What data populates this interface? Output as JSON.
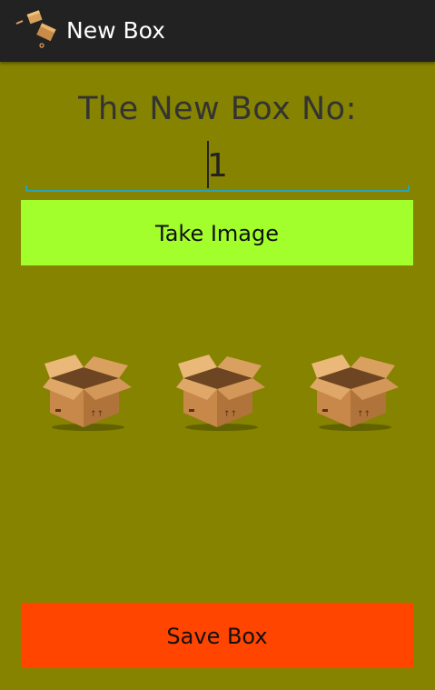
{
  "action_bar": {
    "title": "New Box",
    "icon": "box-app-icon"
  },
  "form": {
    "heading": "The New Box No:",
    "box_number_value": "1"
  },
  "buttons": {
    "take_image": "Take Image",
    "save_box": "Save Box"
  },
  "images": [
    {
      "icon": "cardboard-box-icon"
    },
    {
      "icon": "cardboard-box-icon"
    },
    {
      "icon": "cardboard-box-icon"
    }
  ],
  "colors": {
    "background": "#858300",
    "action_bar": "#222222",
    "take_image_button": "#a3ff2b",
    "save_box_button": "#ff4500",
    "input_underline": "#2aa3b8"
  }
}
